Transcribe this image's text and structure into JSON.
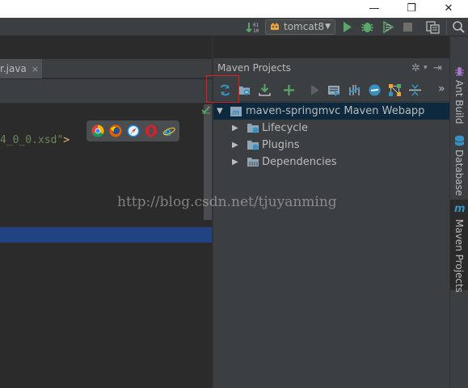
{
  "window": {
    "minimize_glyph": "—",
    "maximize_glyph": "❐",
    "close_glyph": "✕"
  },
  "toolbar": {
    "run_config_label": "tomcat8",
    "icons": [
      "build-binary-icon",
      "tomcat-icon",
      "run-icon",
      "debug-icon",
      "coverage-icon",
      "stop-icon",
      "project-structure-icon"
    ]
  },
  "editor": {
    "tab_label": "r.java",
    "tab_close": "×",
    "code_text": "4_0_0.xsd\"",
    "code_end": ">"
  },
  "browser_popup": {
    "icons": [
      "chrome-icon",
      "firefox-icon",
      "safari-icon",
      "opera-icon",
      "ie-icon"
    ]
  },
  "maven": {
    "title": "Maven Projects",
    "gear_glyph": "✲",
    "pin_glyph": "⇥",
    "more_glyph": "»",
    "toolbar_icons": [
      "reimport-icon",
      "generate-sources-icon",
      "download-icon",
      "add-icon",
      "run-goal-icon",
      "execute-goal-icon",
      "toggle-offline-icon",
      "skip-tests-icon",
      "show-dependencies-icon",
      "collapse-all-icon"
    ],
    "tree": [
      {
        "label": "maven-springmvc Maven Webapp",
        "expanded": true,
        "selected": true
      },
      {
        "label": "Lifecycle",
        "expanded": false
      },
      {
        "label": "Plugins",
        "expanded": false
      },
      {
        "label": "Dependencies",
        "expanded": false
      }
    ]
  },
  "side_stripe": {
    "items": [
      "Ant Build",
      "Database",
      "Maven Projects"
    ]
  },
  "watermark": "http://blog.csdn.net/tjuyanming",
  "colors": {
    "accent_selection": "#214283",
    "tree_selection": "#0d293e",
    "highlight_box": "#e02020",
    "run_green": "#59a869"
  }
}
